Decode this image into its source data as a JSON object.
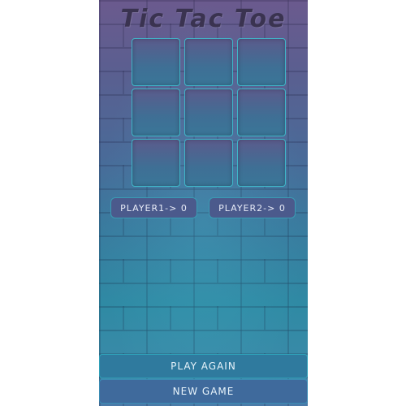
{
  "app": {
    "title": "Tic Tac Toe"
  },
  "board": {
    "cells": [
      "",
      "",
      "",
      "",
      "",
      "",
      "",
      "",
      ""
    ]
  },
  "scores": {
    "player1": "PLAYER1-> 0",
    "player2": "PLAYER2-> 0"
  },
  "buttons": {
    "play_again": "PLAY AGAIN",
    "new_game": "NEW GAME"
  },
  "colors": {
    "accent": "#3fb6c9",
    "button": "#2f7a9e",
    "score_bg": "#4b5a8c",
    "title": "#3a3350"
  }
}
